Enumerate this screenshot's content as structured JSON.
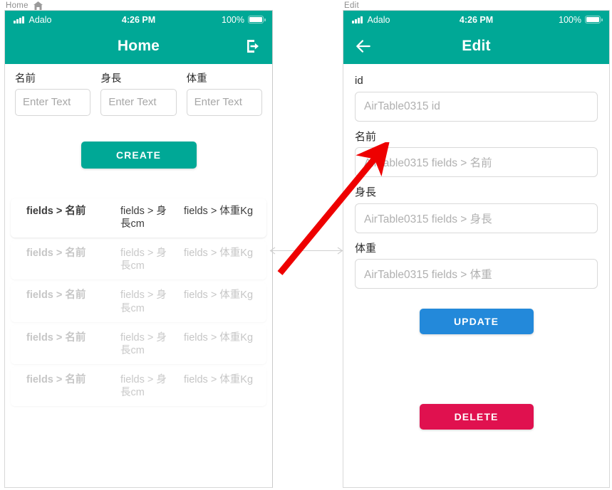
{
  "panels": {
    "left_label": "Home",
    "left_label_icon": "home-icon",
    "right_label": "Edit"
  },
  "status_bar": {
    "carrier": "Adalo",
    "time": "4:26 PM",
    "battery_percent": "100%",
    "signal_icon": "signal-bars-icon",
    "battery_icon": "battery-full-icon"
  },
  "colors": {
    "teal": "#00a896",
    "blue": "#2389da",
    "crimson": "#e0114f",
    "annotation_red": "#ee0000",
    "connector_gray": "#cccccc"
  },
  "home_screen": {
    "title": "Home",
    "logout_icon": "logout-icon",
    "form": {
      "fields": [
        {
          "label": "名前",
          "placeholder": "Enter Text",
          "value": ""
        },
        {
          "label": "身長",
          "placeholder": "Enter Text",
          "value": ""
        },
        {
          "label": "体重",
          "placeholder": "Enter Text",
          "value": ""
        }
      ],
      "submit_label": "CREATE"
    },
    "list": {
      "rows": [
        {
          "name": "fields > 名前",
          "height": "fields > 身長cm",
          "weight": "fields > 体重Kg",
          "muted": false
        },
        {
          "name": "fields > 名前",
          "height": "fields > 身長cm",
          "weight": "fields > 体重Kg",
          "muted": true
        },
        {
          "name": "fields > 名前",
          "height": "fields > 身長cm",
          "weight": "fields > 体重Kg",
          "muted": true
        },
        {
          "name": "fields > 名前",
          "height": "fields > 身長cm",
          "weight": "fields > 体重Kg",
          "muted": true
        },
        {
          "name": "fields > 名前",
          "height": "fields > 身長cm",
          "weight": "fields > 体重Kg",
          "muted": true
        }
      ]
    }
  },
  "edit_screen": {
    "title": "Edit",
    "back_icon": "arrow-left-icon",
    "fields": [
      {
        "label": "id",
        "placeholder": "AirTable0315 id",
        "value": ""
      },
      {
        "label": "名前",
        "placeholder": "AirTable0315 fields > 名前",
        "value": ""
      },
      {
        "label": "身長",
        "placeholder": "AirTable0315 fields > 身長",
        "value": ""
      },
      {
        "label": "体重",
        "placeholder": "AirTable0315 fields > 体重",
        "value": ""
      }
    ],
    "update_label": "UPDATE",
    "delete_label": "DELETE"
  },
  "annotations": {
    "connector_icon": "double-arrow-horizontal",
    "pointer_icon": "red-arrow-up-right"
  }
}
